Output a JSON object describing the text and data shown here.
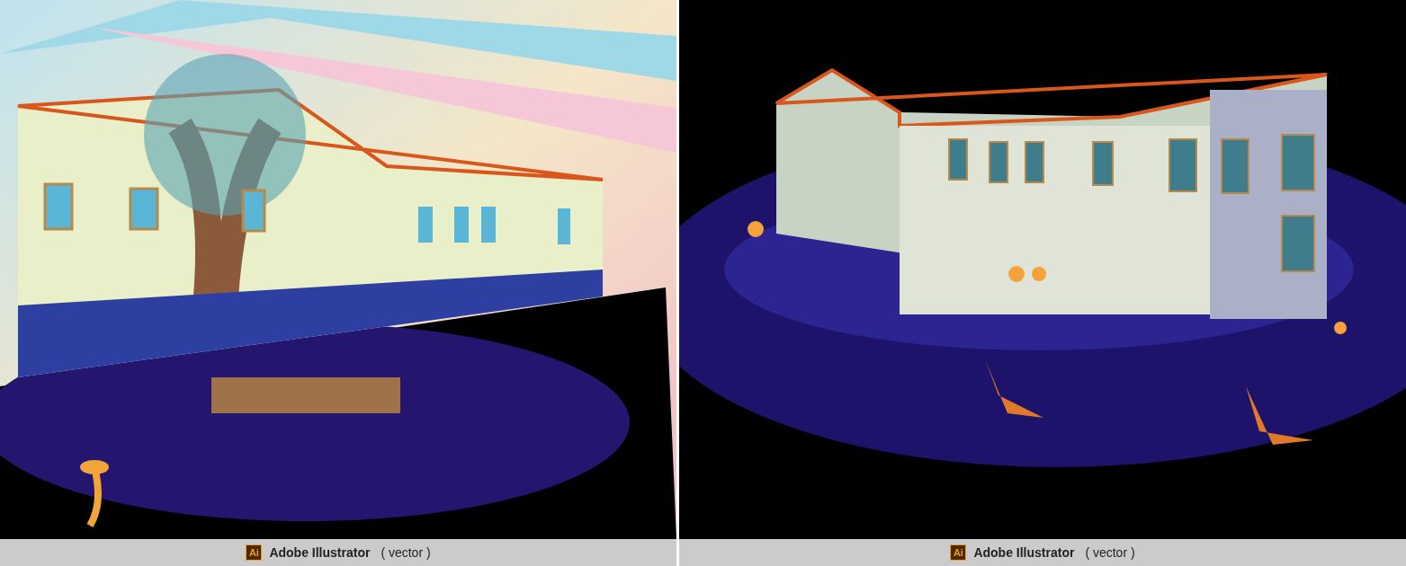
{
  "panels": [
    {
      "kind": "day",
      "caption": {
        "icon": "Ai",
        "app": "Adobe Illustrator",
        "note": "( vector )"
      }
    },
    {
      "kind": "night",
      "caption": {
        "icon": "Ai",
        "app": "Adobe Illustrator",
        "note": "( vector )"
      }
    }
  ]
}
